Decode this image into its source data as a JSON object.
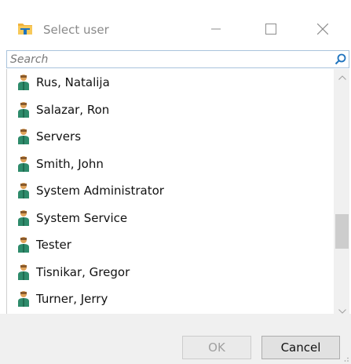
{
  "window": {
    "title": "Select user",
    "buttons": {
      "minimize": "minimize-icon",
      "maximize": "maximize-icon",
      "close": "close-icon"
    }
  },
  "search": {
    "placeholder": "Search",
    "value": ""
  },
  "users": [
    "Rus, Natalija",
    "Salazar, Ron",
    "Servers",
    "Smith, John",
    "System Administrator",
    "System Service",
    "Tester",
    "Tisnikar, Gregor",
    "Turner, Jerry"
  ],
  "footer": {
    "ok_label": "OK",
    "cancel_label": "Cancel",
    "ok_enabled": false
  },
  "colors": {
    "accent": "#1e73be",
    "folder": "#f0b33c",
    "user_head": "#e0a35a",
    "user_body": "#2e8b6b"
  }
}
